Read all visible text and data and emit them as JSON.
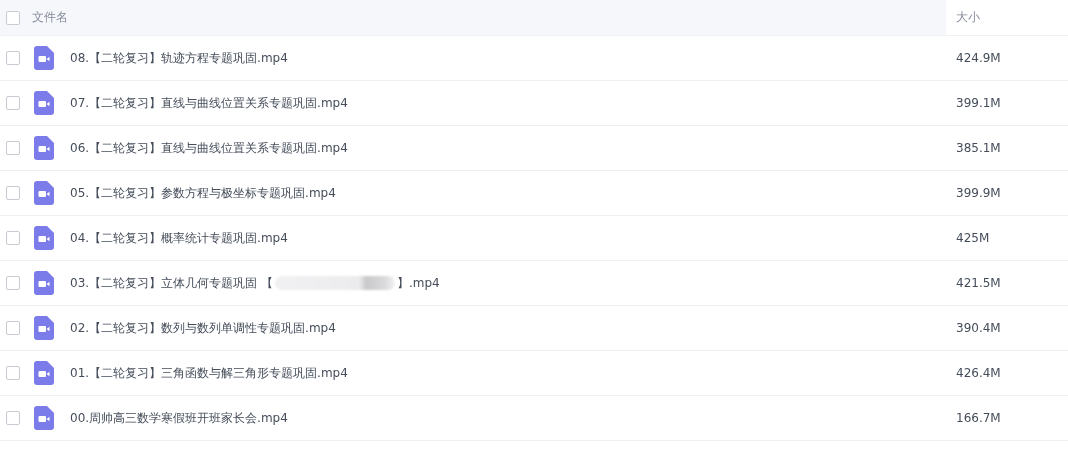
{
  "table": {
    "select_all": {
      "checked": false
    },
    "columns": [
      {
        "label": "文件名"
      },
      {
        "label": "大小"
      }
    ],
    "rows": [
      {
        "checked": false,
        "name": "08.【二轮复习】轨迹方程专题巩固.mp4",
        "blurred": false,
        "size": "424.9M"
      },
      {
        "checked": false,
        "name": "07.【二轮复习】直线与曲线位置关系专题巩固.mp4",
        "blurred": false,
        "size": "399.1M"
      },
      {
        "checked": false,
        "name": "06.【二轮复习】直线与曲线位置关系专题巩固.mp4",
        "blurred": false,
        "size": "385.1M"
      },
      {
        "checked": false,
        "name": "05.【二轮复习】参数方程与极坐标专题巩固.mp4",
        "blurred": false,
        "size": "399.9M"
      },
      {
        "checked": false,
        "name": "04.【二轮复习】概率统计专题巩固.mp4",
        "blurred": false,
        "size": "425M"
      },
      {
        "checked": false,
        "name": "03.【二轮复习】立体几何专题巩固 【",
        "blurred": true,
        "name_after": "】.mp4",
        "size": "421.5M"
      },
      {
        "checked": false,
        "name": "02.【二轮复习】数列与数列单调性专题巩固.mp4",
        "blurred": false,
        "size": "390.4M"
      },
      {
        "checked": false,
        "name": "01.【二轮复习】三角函数与解三角形专题巩固.mp4",
        "blurred": false,
        "size": "426.4M"
      },
      {
        "checked": false,
        "name": "00.周帅高三数学寒假班开班家长会.mp4",
        "blurred": false,
        "size": "166.7M"
      }
    ]
  }
}
